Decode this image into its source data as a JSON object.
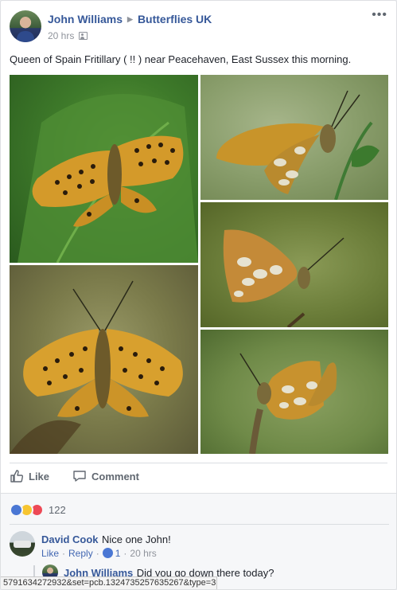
{
  "post": {
    "author": "John Williams",
    "group": "Butterflies UK",
    "time": "20 hrs",
    "more_icon": "more-options-icon",
    "text": "Queen of Spain Fritillary ( !! ) near Peacehaven, East Sussex this morning."
  },
  "actions": {
    "like_label": "Like",
    "comment_label": "Comment"
  },
  "reactions": {
    "count": "122",
    "types": [
      "like",
      "wow",
      "love"
    ]
  },
  "comments": [
    {
      "author": "David Cook",
      "text": "Nice one John!",
      "like_label": "Like",
      "reply_label": "Reply",
      "like_count": "1",
      "time": "20 hrs"
    }
  ],
  "reply": {
    "author": "John Williams",
    "text": "Did you go down there today?"
  },
  "status_url": "5791634272932&set=pcb.1324735257635267&type=3",
  "colors": {
    "link_blue": "#365899",
    "meta_grey": "#90949c",
    "like_blue": "#4a77d4",
    "love_red": "#ed4956",
    "wow_yellow": "#f7c531"
  }
}
